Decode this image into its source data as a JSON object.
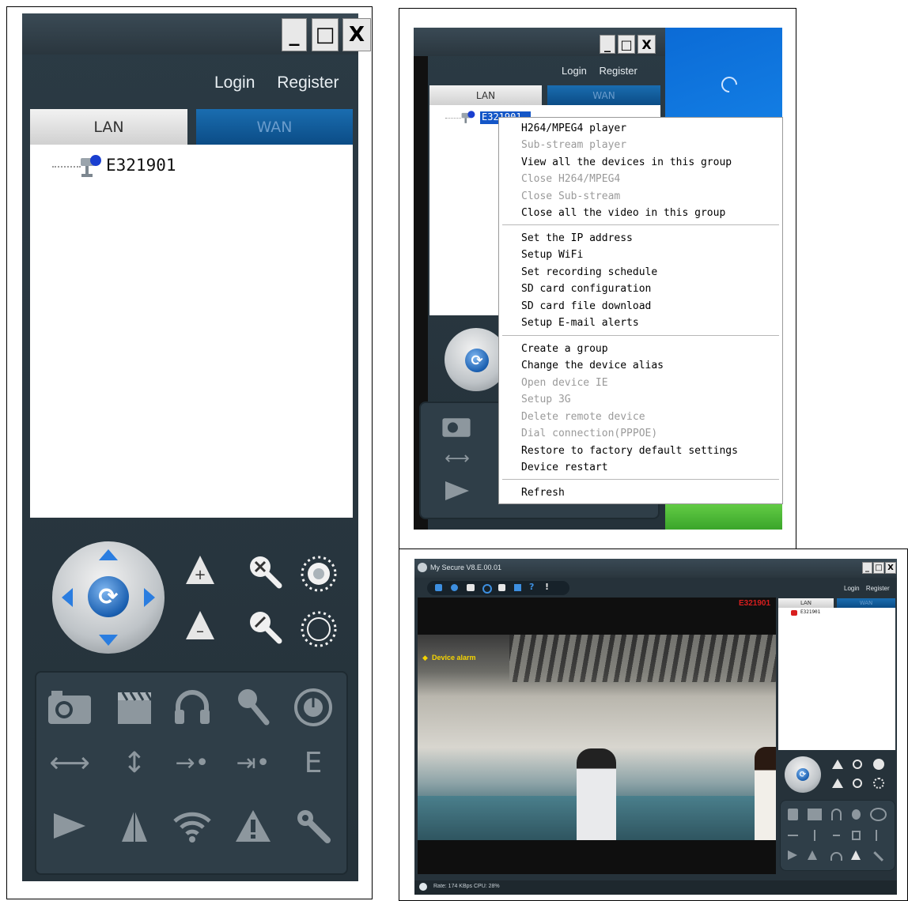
{
  "window_buttons": {
    "minimize": "_",
    "maximize": "□",
    "close": "X"
  },
  "left_panel": {
    "links": {
      "login": "Login",
      "register": "Register"
    },
    "tabs": {
      "lan": "LAN",
      "wan": "WAN"
    },
    "device": "E321901"
  },
  "context_panel": {
    "links": {
      "login": "Login",
      "register": "Register"
    },
    "tabs": {
      "lan": "LAN",
      "wan": "WAN"
    },
    "device": "E321901",
    "menu": {
      "group1": [
        {
          "label": "H264/MPEG4 player",
          "enabled": true
        },
        {
          "label": "Sub-stream player",
          "enabled": false
        },
        {
          "label": "View all the devices in this group",
          "enabled": true
        },
        {
          "label": "Close H264/MPEG4",
          "enabled": false
        },
        {
          "label": "Close Sub-stream",
          "enabled": false
        },
        {
          "label": "Close all the video in this group",
          "enabled": true
        }
      ],
      "group2": [
        {
          "label": "Set the IP address",
          "enabled": true
        },
        {
          "label": "Setup WiFi",
          "enabled": true
        },
        {
          "label": "Set recording schedule",
          "enabled": true
        },
        {
          "label": "SD card configuration",
          "enabled": true
        },
        {
          "label": "SD card file download",
          "enabled": true
        },
        {
          "label": "Setup E-mail alerts",
          "enabled": true
        }
      ],
      "group3": [
        {
          "label": "Create a group",
          "enabled": true
        },
        {
          "label": "Change the device alias",
          "enabled": true
        },
        {
          "label": "Open device IE",
          "enabled": false
        },
        {
          "label": "Setup 3G",
          "enabled": false
        },
        {
          "label": "Delete remote device",
          "enabled": false
        },
        {
          "label": "Dial connection(PPPOE)",
          "enabled": false
        },
        {
          "label": "Restore to factory default settings",
          "enabled": true
        },
        {
          "label": "Device restart",
          "enabled": true
        }
      ],
      "group4": [
        {
          "label": "Refresh",
          "enabled": true
        }
      ]
    }
  },
  "main_window": {
    "title": "My Secure  V8.E.00.01",
    "links": {
      "login": "Login",
      "register": "Register"
    },
    "tabs": {
      "lan": "LAN",
      "wan": "WAN"
    },
    "device": "E321901",
    "video_label": "E321901",
    "alarm_text": "Device alarm",
    "status": "Rate: 174 KBps  CPU: 28%"
  },
  "colors": {
    "accent_blue": "#0b4c86",
    "alarm_red": "#d81e1e",
    "alarm_yellow": "#f5d400"
  }
}
